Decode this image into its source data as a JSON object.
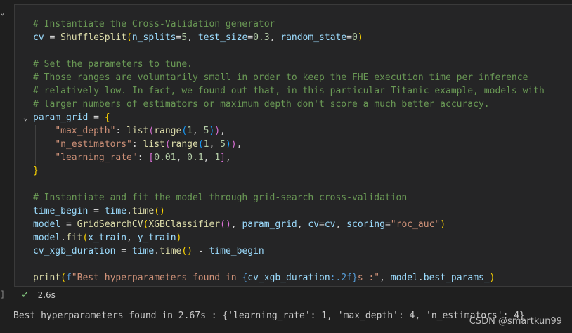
{
  "cell": {
    "lines": [
      [
        {
          "t": "# Instantiate the Cross-Validation generator",
          "c": "comment"
        }
      ],
      [
        {
          "t": "cv",
          "c": "var"
        },
        {
          "t": " = ",
          "c": "op"
        },
        {
          "t": "ShuffleSplit",
          "c": "func"
        },
        {
          "t": "(",
          "c": "brace"
        },
        {
          "t": "n_splits",
          "c": "var"
        },
        {
          "t": "=",
          "c": "op"
        },
        {
          "t": "5",
          "c": "num"
        },
        {
          "t": ", ",
          "c": "op"
        },
        {
          "t": "test_size",
          "c": "var"
        },
        {
          "t": "=",
          "c": "op"
        },
        {
          "t": "0.3",
          "c": "num"
        },
        {
          "t": ", ",
          "c": "op"
        },
        {
          "t": "random_state",
          "c": "var"
        },
        {
          "t": "=",
          "c": "op"
        },
        {
          "t": "0",
          "c": "num"
        },
        {
          "t": ")",
          "c": "brace"
        }
      ],
      [],
      [
        {
          "t": "# Set the parameters to tune.",
          "c": "comment"
        }
      ],
      [
        {
          "t": "# Those ranges are voluntarily small in order to keep the FHE execution time per inference",
          "c": "comment"
        }
      ],
      [
        {
          "t": "# relatively low. In fact, we found out that, in this particular Titanic example, models with",
          "c": "comment"
        }
      ],
      [
        {
          "t": "# larger numbers of estimators or maximum depth don't score a much better accuracy.",
          "c": "comment"
        }
      ],
      [
        {
          "t": "param_grid",
          "c": "var"
        },
        {
          "t": " = ",
          "c": "op"
        },
        {
          "t": "{",
          "c": "brace"
        }
      ],
      [
        {
          "t": "    ",
          "c": "op"
        },
        {
          "t": "\"max_depth\"",
          "c": "str"
        },
        {
          "t": ": ",
          "c": "op"
        },
        {
          "t": "list",
          "c": "func"
        },
        {
          "t": "(",
          "c": "paren2"
        },
        {
          "t": "range",
          "c": "func"
        },
        {
          "t": "(",
          "c": "paren3"
        },
        {
          "t": "1",
          "c": "num"
        },
        {
          "t": ", ",
          "c": "op"
        },
        {
          "t": "5",
          "c": "num"
        },
        {
          "t": ")",
          "c": "paren3"
        },
        {
          "t": ")",
          "c": "paren2"
        },
        {
          "t": ",",
          "c": "op"
        }
      ],
      [
        {
          "t": "    ",
          "c": "op"
        },
        {
          "t": "\"n_estimators\"",
          "c": "str"
        },
        {
          "t": ": ",
          "c": "op"
        },
        {
          "t": "list",
          "c": "func"
        },
        {
          "t": "(",
          "c": "paren2"
        },
        {
          "t": "range",
          "c": "func"
        },
        {
          "t": "(",
          "c": "paren3"
        },
        {
          "t": "1",
          "c": "num"
        },
        {
          "t": ", ",
          "c": "op"
        },
        {
          "t": "5",
          "c": "num"
        },
        {
          "t": ")",
          "c": "paren3"
        },
        {
          "t": ")",
          "c": "paren2"
        },
        {
          "t": ",",
          "c": "op"
        }
      ],
      [
        {
          "t": "    ",
          "c": "op"
        },
        {
          "t": "\"learning_rate\"",
          "c": "str"
        },
        {
          "t": ": ",
          "c": "op"
        },
        {
          "t": "[",
          "c": "paren2"
        },
        {
          "t": "0.01",
          "c": "num"
        },
        {
          "t": ", ",
          "c": "op"
        },
        {
          "t": "0.1",
          "c": "num"
        },
        {
          "t": ", ",
          "c": "op"
        },
        {
          "t": "1",
          "c": "num"
        },
        {
          "t": "]",
          "c": "paren2"
        },
        {
          "t": ",",
          "c": "op"
        }
      ],
      [
        {
          "t": "}",
          "c": "brace"
        }
      ],
      [],
      [
        {
          "t": "# Instantiate and fit the model through grid-search cross-validation",
          "c": "comment"
        }
      ],
      [
        {
          "t": "time_begin",
          "c": "var"
        },
        {
          "t": " = ",
          "c": "op"
        },
        {
          "t": "time",
          "c": "var"
        },
        {
          "t": ".",
          "c": "op"
        },
        {
          "t": "time",
          "c": "func"
        },
        {
          "t": "()",
          "c": "brace"
        }
      ],
      [
        {
          "t": "model",
          "c": "var"
        },
        {
          "t": " = ",
          "c": "op"
        },
        {
          "t": "GridSearchCV",
          "c": "func"
        },
        {
          "t": "(",
          "c": "brace"
        },
        {
          "t": "XGBClassifier",
          "c": "func"
        },
        {
          "t": "()",
          "c": "paren2"
        },
        {
          "t": ", ",
          "c": "op"
        },
        {
          "t": "param_grid",
          "c": "var"
        },
        {
          "t": ", ",
          "c": "op"
        },
        {
          "t": "cv",
          "c": "var"
        },
        {
          "t": "=",
          "c": "op"
        },
        {
          "t": "cv",
          "c": "var"
        },
        {
          "t": ", ",
          "c": "op"
        },
        {
          "t": "scoring",
          "c": "var"
        },
        {
          "t": "=",
          "c": "op"
        },
        {
          "t": "\"roc_auc\"",
          "c": "str"
        },
        {
          "t": ")",
          "c": "brace"
        }
      ],
      [
        {
          "t": "model",
          "c": "var"
        },
        {
          "t": ".",
          "c": "op"
        },
        {
          "t": "fit",
          "c": "func"
        },
        {
          "t": "(",
          "c": "brace"
        },
        {
          "t": "x_train",
          "c": "var"
        },
        {
          "t": ", ",
          "c": "op"
        },
        {
          "t": "y_train",
          "c": "var"
        },
        {
          "t": ")",
          "c": "brace"
        }
      ],
      [
        {
          "t": "cv_xgb_duration",
          "c": "var"
        },
        {
          "t": " = ",
          "c": "op"
        },
        {
          "t": "time",
          "c": "var"
        },
        {
          "t": ".",
          "c": "op"
        },
        {
          "t": "time",
          "c": "func"
        },
        {
          "t": "()",
          "c": "brace"
        },
        {
          "t": " - ",
          "c": "op"
        },
        {
          "t": "time_begin",
          "c": "var"
        }
      ],
      [],
      [
        {
          "t": "print",
          "c": "func"
        },
        {
          "t": "(",
          "c": "brace"
        },
        {
          "t": "f",
          "c": "kw"
        },
        {
          "t": "\"Best hyperparameters found in ",
          "c": "str"
        },
        {
          "t": "{",
          "c": "kw"
        },
        {
          "t": "cv_xgb_duration",
          "c": "var"
        },
        {
          "t": ":.2f",
          "c": "kw"
        },
        {
          "t": "}",
          "c": "kw"
        },
        {
          "t": "s :\"",
          "c": "str"
        },
        {
          "t": ", ",
          "c": "op"
        },
        {
          "t": "model",
          "c": "var"
        },
        {
          "t": ".",
          "c": "op"
        },
        {
          "t": "best_params_",
          "c": "var"
        },
        {
          "t": ")",
          "c": "brace"
        }
      ]
    ]
  },
  "status": {
    "duration": "2.6s"
  },
  "output": {
    "text": "Best hyperparameters found in 2.67s : {'learning_rate': 1, 'max_depth': 4, 'n_estimators': 4}"
  },
  "watermark": "CSDN @smartkun99",
  "icons": {
    "collapse": "chevron-down-icon",
    "fold": "chevron-down-icon",
    "check": "check-icon"
  },
  "colors": {
    "background": "#1f1f1f",
    "cell_background": "#252526",
    "comment": "#6a9955",
    "string": "#ce9178",
    "function": "#dcdcaa",
    "variable": "#9cdcfe",
    "number": "#b5cea8",
    "success": "#89d185"
  }
}
